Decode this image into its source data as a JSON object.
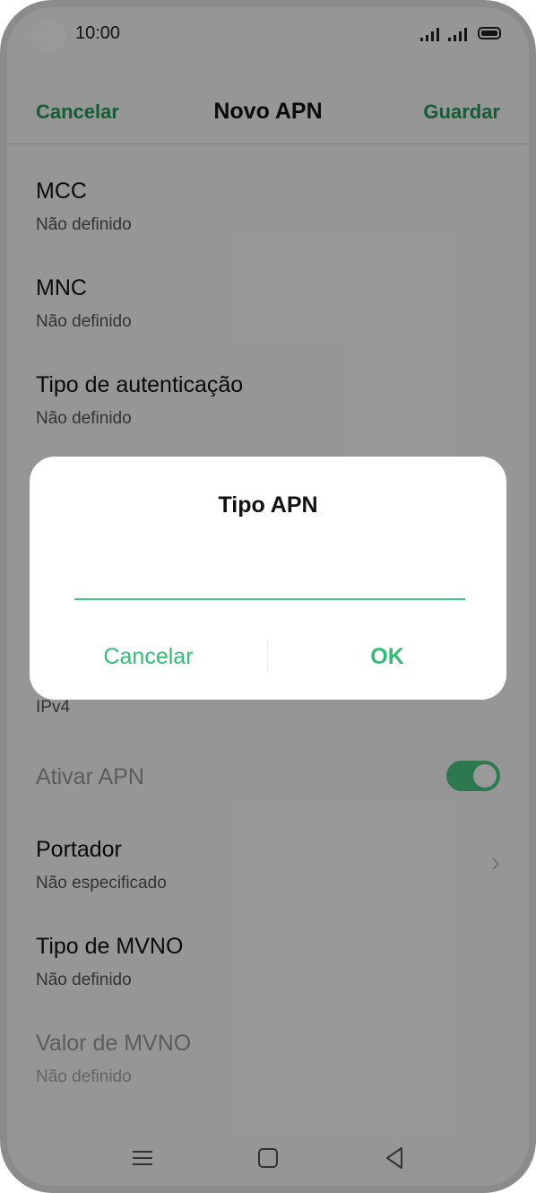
{
  "status_bar": {
    "time": "10:00",
    "icons": [
      "camera-cutout",
      "signal-icon",
      "signal-icon",
      "battery-icon"
    ]
  },
  "header": {
    "cancel_label": "Cancelar",
    "title": "Novo APN",
    "save_label": "Guardar"
  },
  "settings": [
    {
      "title": "MCC",
      "value": "Não definido"
    },
    {
      "title": "MNC",
      "value": "Não definido"
    },
    {
      "title": "Tipo de autenticação",
      "value": "Não definido"
    },
    {
      "title": "",
      "value": "IPv4"
    },
    {
      "title": "Ativar APN",
      "enabled": true,
      "disabled": true
    },
    {
      "title": "Portador",
      "value": "Não especificado",
      "chevron": "chevron-right-icon"
    },
    {
      "title": "Tipo de MVNO",
      "value": "Não definido"
    },
    {
      "title": "Valor de MVNO",
      "value": "Não definido",
      "disabled": true
    }
  ],
  "dialog": {
    "title": "Tipo APN",
    "input_value": "",
    "cancel_label": "Cancelar",
    "ok_label": "OK"
  },
  "nav_bar": {
    "icons": [
      "menu-icon",
      "home-icon",
      "back-icon"
    ]
  },
  "colors": {
    "accent": "#1e9d57",
    "dialog_accent": "#2fbf73",
    "toggle_on": "#4cc982"
  }
}
